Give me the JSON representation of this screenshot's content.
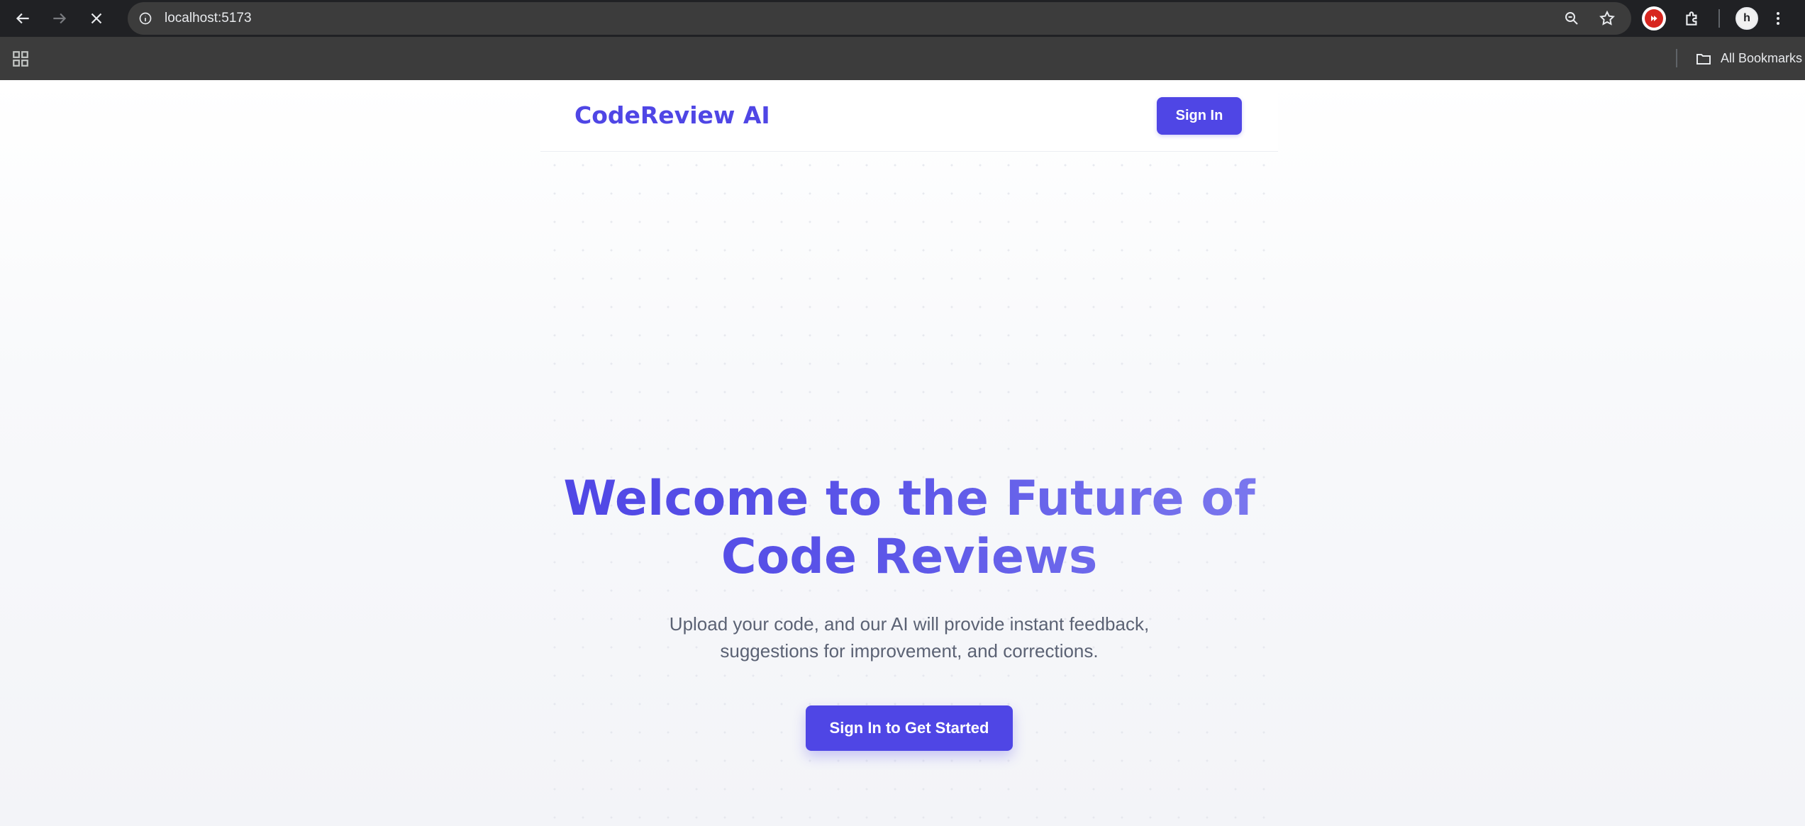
{
  "browser": {
    "url": "localhost:5173",
    "bookmarks_label": "All Bookmarks",
    "icons": {
      "back": "arrow-left-icon",
      "forward": "arrow-right-icon",
      "stop": "close-icon",
      "site_info": "info-icon",
      "zoom": "zoom-icon",
      "bookmark": "star-icon",
      "extension": "puzzle-icon",
      "menu": "kebab-icon",
      "apps": "apps-grid-icon",
      "folder": "folder-icon"
    }
  },
  "header": {
    "brand": "CodeReview AI",
    "signin_label": "Sign In"
  },
  "hero": {
    "title_line1": "Welcome to the Future of",
    "title_line2": "Code Reviews",
    "subtitle_line1": "Upload your code, and our AI will provide instant feedback,",
    "subtitle_line2": "suggestions for improvement, and corrections.",
    "cta_label": "Sign In to Get Started"
  },
  "colors": {
    "accent": "#4f46e5",
    "accent_light": "#7c79ee",
    "subtitle": "#5b6274",
    "chrome_dark": "#202124"
  }
}
